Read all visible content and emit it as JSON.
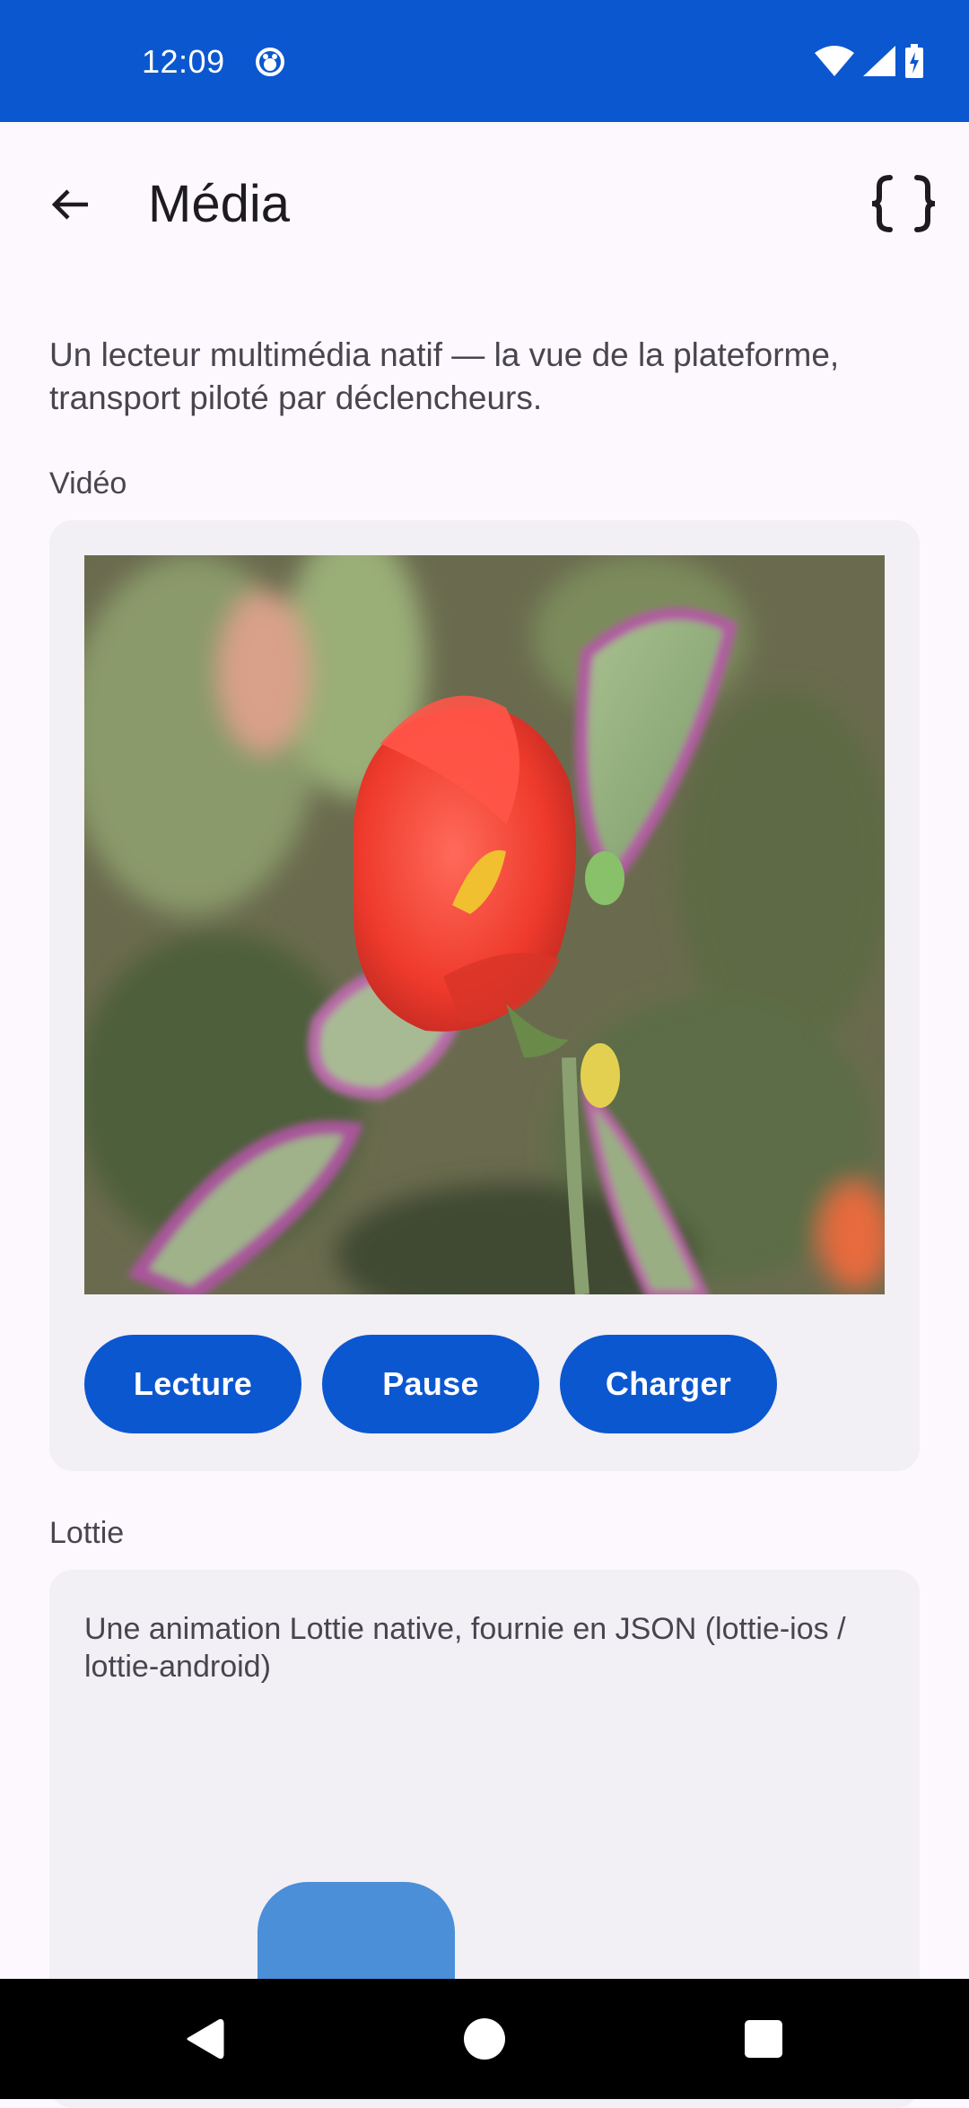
{
  "status_bar": {
    "time": "12:09",
    "icons": [
      "app-notification-icon",
      "wifi-icon",
      "signal-icon",
      "battery-charging-icon"
    ]
  },
  "app_bar": {
    "title": "Média",
    "back_icon": "arrow-back-icon",
    "action_icon": "json-braces-icon"
  },
  "intro": "Un lecteur multimédia natif — la vue de la plateforme, transport piloté par déclencheurs.",
  "video_section": {
    "label": "Vidéo",
    "buttons": [
      {
        "label": "Lecture"
      },
      {
        "label": "Pause"
      },
      {
        "label": "Charger"
      }
    ]
  },
  "lottie_section": {
    "label": "Lottie",
    "description": "Une animation Lottie native, fournie en JSON (lottie-ios / lottie-android)"
  },
  "nav_bar": {
    "buttons": [
      "back-triangle-icon",
      "home-circle-icon",
      "recents-square-icon"
    ]
  },
  "colors": {
    "primary": "#0b57d0",
    "background": "#fdf8fd",
    "card": "#f2eff5",
    "lottie_shape": "#4a8fd8"
  }
}
